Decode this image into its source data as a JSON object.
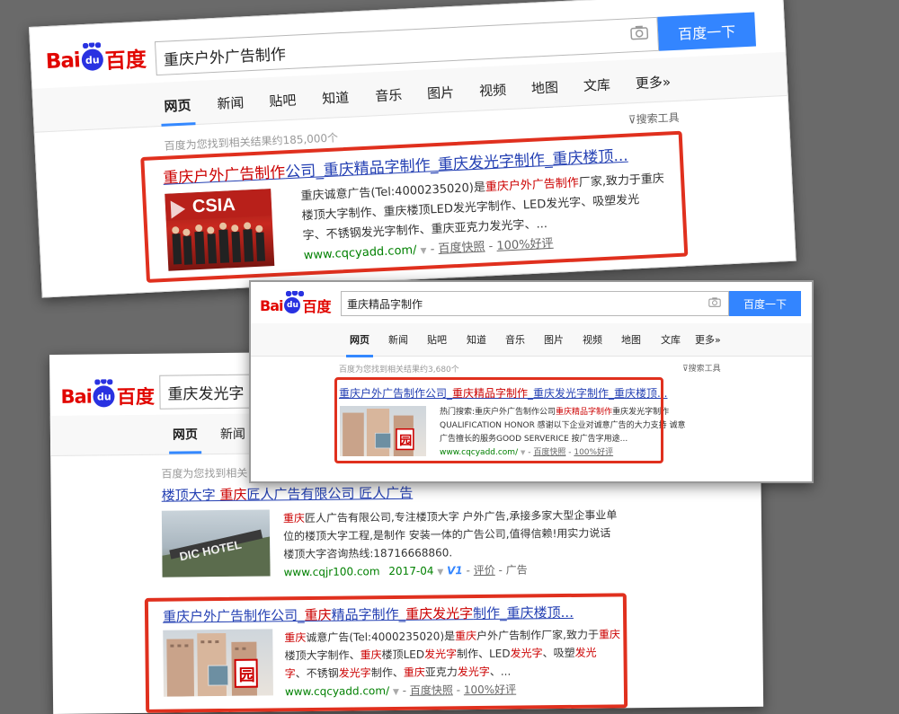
{
  "brand": {
    "bai": "Bai",
    "du": "du",
    "cn": "百度"
  },
  "common": {
    "tabs": [
      "网页",
      "新闻",
      "贴吧",
      "知道",
      "音乐",
      "图片",
      "视频",
      "地图",
      "文库",
      "更多»"
    ],
    "search_button": "百度一下",
    "tools": "搜索工具",
    "camera_icon": "camera-icon",
    "accent": "#3385ff",
    "brand_red": "#e10601",
    "highlight_box": "#e0301e"
  },
  "shot1": {
    "query": "重庆户外广告制作",
    "count": "百度为您找到相关结果约185,000个",
    "result": {
      "title_hl": "重庆户外广告制作",
      "title_rest": "公司_重庆精品字制作_重庆发光字制作_重庆楼顶...",
      "desc_l1_a": "重庆诚意广告(Tel:4000235020)是",
      "desc_l1_hl": "重庆户外广告制作",
      "desc_l1_b": "厂家,致力于重庆",
      "desc_l2": "楼顶大字制作、重庆楼顶LED发光字制作、LED发光字、吸塑发光",
      "desc_l3": "字、不锈钢发光字制作、重庆亚克力发光字、...",
      "url": "www.cqcyadd.com/",
      "snapshot": "百度快照",
      "rating": "100%好评"
    }
  },
  "shot2": {
    "query": "重庆精品字制作",
    "count": "百度为您找到相关结果约3,680个",
    "result": {
      "title_a": "重庆户外广告制作公司_",
      "title_hl": "重庆精品字制作",
      "title_b": "_重庆发光字制作_重庆楼顶...",
      "desc_l1_a": "热门搜索:重庆户外广告制作公司",
      "desc_l1_hl": "重庆精品字制作",
      "desc_l1_b": "重庆发光字制作",
      "desc_l2": "QUALIFICATION HONOR 感谢以下企业对诚意广告的大力支持 诚意",
      "desc_l3": "广告擅长的服务GOOD SERVERICE 按广告字用途...",
      "url": "www.cqcyadd.com/",
      "snapshot": "百度快照",
      "rating": "100%好评"
    }
  },
  "shot3": {
    "query": "重庆发光字",
    "tabs_visible": [
      "网页",
      "新闻"
    ],
    "count": "百度为您找到相关",
    "result1": {
      "title_a": "楼顶大字 ",
      "title_hl": "重庆",
      "title_b": "匠人广告有限公司 匠人广告",
      "desc_l1_hl": "重庆",
      "desc_l1": "匠人广告有限公司,专注楼顶大字 户外广告,承接多家大型企事业单",
      "desc_l2": "位的楼顶大字工程,是制作 安装一体的广告公司,值得信赖!用实力说话",
      "desc_l3": "楼顶大字咨询热线:18716668860.",
      "url": "www.cqjr100.com",
      "date": "2017-04",
      "v_badge": "V1",
      "reviews": "评价",
      "ad": "广告"
    },
    "result2": {
      "title_a": "重庆户外广告制作公司_",
      "title_hl1": "重庆",
      "title_b": "精品字制作_",
      "title_hl2": "重庆发光字",
      "title_c": "制作_重庆楼顶...",
      "desc_l1_hl1": "重庆",
      "desc_l1_a": "诚意广告(Tel:4000235020)是",
      "desc_l1_hl2": "重庆",
      "desc_l1_b": "户外广告制作厂家,致力于",
      "desc_l1_hl3": "重庆",
      "desc_l2_a": "楼顶大字制作、",
      "desc_l2_hl1": "重庆",
      "desc_l2_b": "楼顶LED",
      "desc_l2_hl2": "发光字",
      "desc_l2_c": "制作、LED",
      "desc_l2_hl3": "发光字",
      "desc_l2_d": "、吸塑",
      "desc_l2_hl4": "发光",
      "desc_l3_hl1": "字",
      "desc_l3_a": "、不锈钢",
      "desc_l3_hl2": "发光字",
      "desc_l3_b": "制作、",
      "desc_l3_hl3": "重庆",
      "desc_l3_c": "亚克力",
      "desc_l3_hl4": "发光字",
      "desc_l3_d": "、...",
      "url": "www.cqcyadd.com/",
      "snapshot": "百度快照",
      "rating": "100%好评"
    }
  }
}
